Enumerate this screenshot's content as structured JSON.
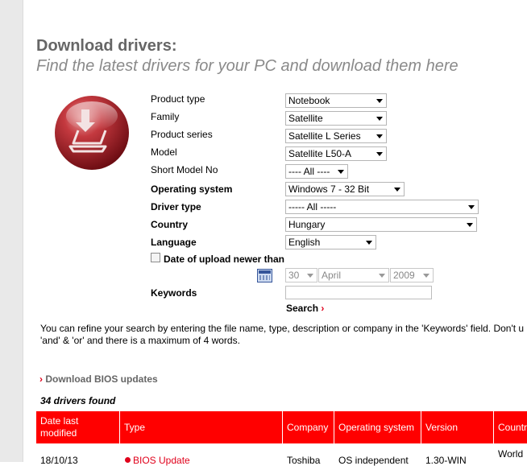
{
  "header": {
    "title": "Download drivers:",
    "subtitle": "Find the latest drivers for your PC and download them here"
  },
  "form": {
    "product_type": {
      "label": "Product type",
      "value": "Notebook"
    },
    "family": {
      "label": "Family",
      "value": "Satellite"
    },
    "product_series": {
      "label": "Product series",
      "value": "Satellite L Series"
    },
    "model": {
      "label": "Model",
      "value": "Satellite L50-A"
    },
    "short_model_no": {
      "label": "Short Model No",
      "value": "---- All ----"
    },
    "operating_system": {
      "label": "Operating system",
      "value": "Windows 7 - 32 Bit"
    },
    "driver_type": {
      "label": "Driver type",
      "value": "----- All -----"
    },
    "country": {
      "label": "Country",
      "value": "Hungary"
    },
    "language": {
      "label": "Language",
      "value": "English"
    },
    "date_of_upload": {
      "label": "Date of upload newer than",
      "checked": false,
      "day": "30",
      "month": "April",
      "year": "2009"
    },
    "keywords": {
      "label": "Keywords",
      "value": ""
    },
    "search_label": "Search",
    "search_chevron": "›"
  },
  "info": {
    "line1": "You can refine your search by entering the file name, type, description or company in the 'Keywords' field. Don't u",
    "line2": "'and' & 'or' and there is a maximum of 4 words."
  },
  "bios_link": {
    "chevron": "›",
    "label": "Download BIOS updates"
  },
  "results": {
    "count_text": "34 drivers found",
    "columns": [
      "Date last modified",
      "Type",
      "Company",
      "Operating system",
      "Version",
      "Countr"
    ],
    "rows": [
      {
        "date": "18/10/13",
        "type": "BIOS Update",
        "company": "Toshiba",
        "os": "OS independent",
        "version": "1.30-WIN",
        "country": "World"
      }
    ]
  },
  "colors": {
    "accent": "#ff0000",
    "link": "#e0001b",
    "title": "#666666",
    "subtitle": "#8a8a8a"
  },
  "icons": {
    "logo": "download-notebook-icon",
    "calendar": "calendar-icon",
    "dropdown": "chevron-down-icon"
  }
}
